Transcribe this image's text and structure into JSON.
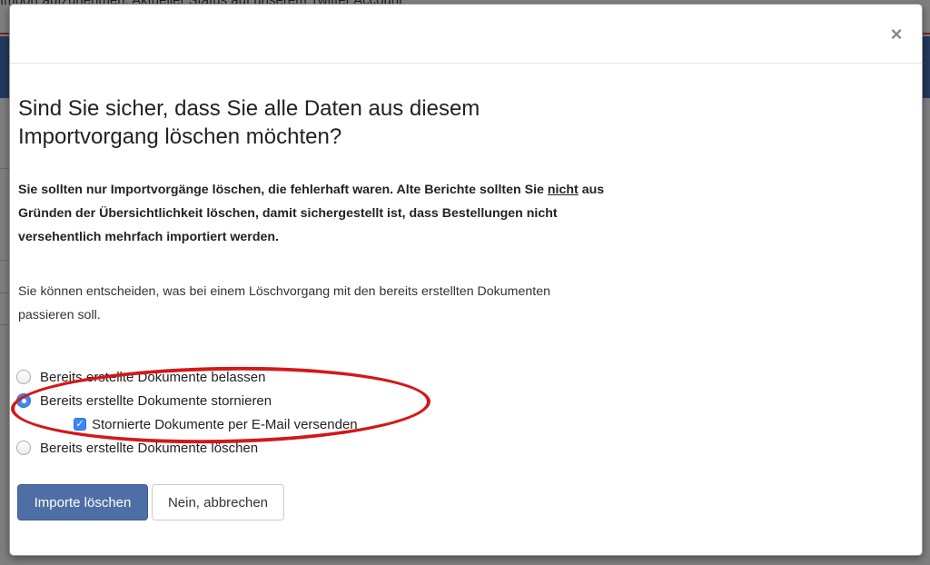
{
  "background": {
    "top_text": "Import aufzunehmen. Aktueller Status auf unserem Twitter Account",
    "navbar_color": "#233a5e"
  },
  "modal": {
    "close_label": "×",
    "title": "Sind Sie sicher, dass Sie alle Daten aus diesem Importvorgang löschen möchten?",
    "warning": {
      "part1": "Sie sollten nur Importvorgänge löschen, die fehlerhaft waren. Alte Berichte sollten Sie ",
      "emphasis": "nicht",
      "part2": " aus Gründen der Übersichtlichkeit löschen, damit sichergestellt ist, dass Bestellungen nicht versehentlich mehrfach importiert werden."
    },
    "info": "Sie können entscheiden, was bei einem Löschvorgang mit den bereits erstellten Dokumenten passieren soll.",
    "options": [
      {
        "label": "Bereits erstellte Dokumente belassen",
        "checked": false
      },
      {
        "label": "Bereits erstellte Dokumente stornieren",
        "checked": true
      },
      {
        "label": "Bereits erstellte Dokumente löschen",
        "checked": false
      }
    ],
    "sub_option": {
      "label": "Stornierte Dokumente per E-Mail versenden",
      "checked": true
    },
    "buttons": {
      "confirm": "Importe löschen",
      "cancel": "Nein, abbrechen"
    },
    "colors": {
      "primary": "#4e6fa5",
      "radio_checked": "#3b88f5",
      "annotation": "#d31818"
    }
  }
}
